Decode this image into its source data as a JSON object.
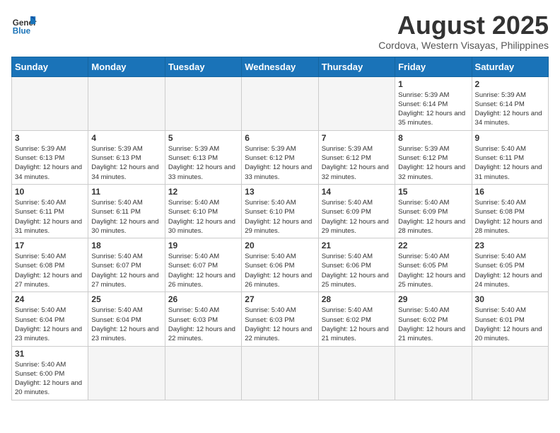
{
  "header": {
    "logo_text_regular": "General",
    "logo_text_blue": "Blue",
    "month_title": "August 2025",
    "subtitle": "Cordova, Western Visayas, Philippines"
  },
  "weekdays": [
    "Sunday",
    "Monday",
    "Tuesday",
    "Wednesday",
    "Thursday",
    "Friday",
    "Saturday"
  ],
  "weeks": [
    [
      {
        "day": "",
        "info": ""
      },
      {
        "day": "",
        "info": ""
      },
      {
        "day": "",
        "info": ""
      },
      {
        "day": "",
        "info": ""
      },
      {
        "day": "",
        "info": ""
      },
      {
        "day": "1",
        "info": "Sunrise: 5:39 AM\nSunset: 6:14 PM\nDaylight: 12 hours\nand 35 minutes."
      },
      {
        "day": "2",
        "info": "Sunrise: 5:39 AM\nSunset: 6:14 PM\nDaylight: 12 hours\nand 34 minutes."
      }
    ],
    [
      {
        "day": "3",
        "info": "Sunrise: 5:39 AM\nSunset: 6:13 PM\nDaylight: 12 hours\nand 34 minutes."
      },
      {
        "day": "4",
        "info": "Sunrise: 5:39 AM\nSunset: 6:13 PM\nDaylight: 12 hours\nand 34 minutes."
      },
      {
        "day": "5",
        "info": "Sunrise: 5:39 AM\nSunset: 6:13 PM\nDaylight: 12 hours\nand 33 minutes."
      },
      {
        "day": "6",
        "info": "Sunrise: 5:39 AM\nSunset: 6:12 PM\nDaylight: 12 hours\nand 33 minutes."
      },
      {
        "day": "7",
        "info": "Sunrise: 5:39 AM\nSunset: 6:12 PM\nDaylight: 12 hours\nand 32 minutes."
      },
      {
        "day": "8",
        "info": "Sunrise: 5:39 AM\nSunset: 6:12 PM\nDaylight: 12 hours\nand 32 minutes."
      },
      {
        "day": "9",
        "info": "Sunrise: 5:40 AM\nSunset: 6:11 PM\nDaylight: 12 hours\nand 31 minutes."
      }
    ],
    [
      {
        "day": "10",
        "info": "Sunrise: 5:40 AM\nSunset: 6:11 PM\nDaylight: 12 hours\nand 31 minutes."
      },
      {
        "day": "11",
        "info": "Sunrise: 5:40 AM\nSunset: 6:11 PM\nDaylight: 12 hours\nand 30 minutes."
      },
      {
        "day": "12",
        "info": "Sunrise: 5:40 AM\nSunset: 6:10 PM\nDaylight: 12 hours\nand 30 minutes."
      },
      {
        "day": "13",
        "info": "Sunrise: 5:40 AM\nSunset: 6:10 PM\nDaylight: 12 hours\nand 29 minutes."
      },
      {
        "day": "14",
        "info": "Sunrise: 5:40 AM\nSunset: 6:09 PM\nDaylight: 12 hours\nand 29 minutes."
      },
      {
        "day": "15",
        "info": "Sunrise: 5:40 AM\nSunset: 6:09 PM\nDaylight: 12 hours\nand 28 minutes."
      },
      {
        "day": "16",
        "info": "Sunrise: 5:40 AM\nSunset: 6:08 PM\nDaylight: 12 hours\nand 28 minutes."
      }
    ],
    [
      {
        "day": "17",
        "info": "Sunrise: 5:40 AM\nSunset: 6:08 PM\nDaylight: 12 hours\nand 27 minutes."
      },
      {
        "day": "18",
        "info": "Sunrise: 5:40 AM\nSunset: 6:07 PM\nDaylight: 12 hours\nand 27 minutes."
      },
      {
        "day": "19",
        "info": "Sunrise: 5:40 AM\nSunset: 6:07 PM\nDaylight: 12 hours\nand 26 minutes."
      },
      {
        "day": "20",
        "info": "Sunrise: 5:40 AM\nSunset: 6:06 PM\nDaylight: 12 hours\nand 26 minutes."
      },
      {
        "day": "21",
        "info": "Sunrise: 5:40 AM\nSunset: 6:06 PM\nDaylight: 12 hours\nand 25 minutes."
      },
      {
        "day": "22",
        "info": "Sunrise: 5:40 AM\nSunset: 6:05 PM\nDaylight: 12 hours\nand 25 minutes."
      },
      {
        "day": "23",
        "info": "Sunrise: 5:40 AM\nSunset: 6:05 PM\nDaylight: 12 hours\nand 24 minutes."
      }
    ],
    [
      {
        "day": "24",
        "info": "Sunrise: 5:40 AM\nSunset: 6:04 PM\nDaylight: 12 hours\nand 23 minutes."
      },
      {
        "day": "25",
        "info": "Sunrise: 5:40 AM\nSunset: 6:04 PM\nDaylight: 12 hours\nand 23 minutes."
      },
      {
        "day": "26",
        "info": "Sunrise: 5:40 AM\nSunset: 6:03 PM\nDaylight: 12 hours\nand 22 minutes."
      },
      {
        "day": "27",
        "info": "Sunrise: 5:40 AM\nSunset: 6:03 PM\nDaylight: 12 hours\nand 22 minutes."
      },
      {
        "day": "28",
        "info": "Sunrise: 5:40 AM\nSunset: 6:02 PM\nDaylight: 12 hours\nand 21 minutes."
      },
      {
        "day": "29",
        "info": "Sunrise: 5:40 AM\nSunset: 6:02 PM\nDaylight: 12 hours\nand 21 minutes."
      },
      {
        "day": "30",
        "info": "Sunrise: 5:40 AM\nSunset: 6:01 PM\nDaylight: 12 hours\nand 20 minutes."
      }
    ],
    [
      {
        "day": "31",
        "info": "Sunrise: 5:40 AM\nSunset: 6:00 PM\nDaylight: 12 hours\nand 20 minutes."
      },
      {
        "day": "",
        "info": ""
      },
      {
        "day": "",
        "info": ""
      },
      {
        "day": "",
        "info": ""
      },
      {
        "day": "",
        "info": ""
      },
      {
        "day": "",
        "info": ""
      },
      {
        "day": "",
        "info": ""
      }
    ]
  ]
}
